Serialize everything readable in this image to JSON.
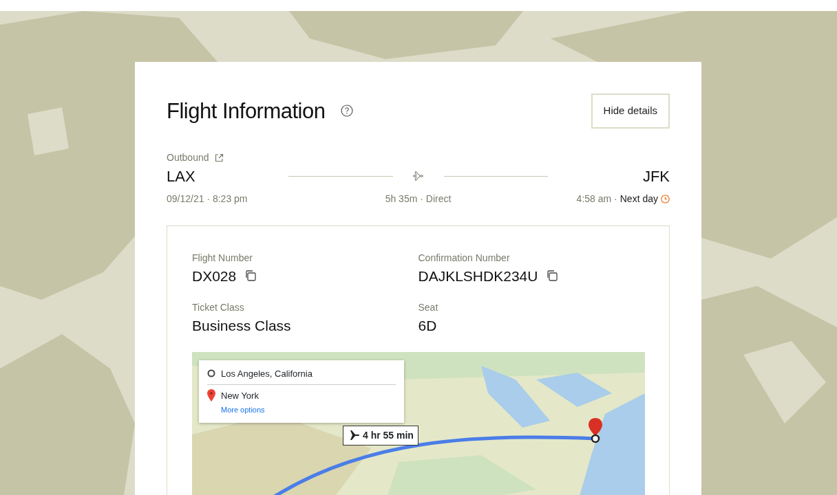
{
  "card": {
    "title": "Flight Information",
    "button": "Hide details"
  },
  "trip": {
    "label": "Outbound",
    "origin": "LAX",
    "destination": "JFK",
    "departure": "09/12/21 · 8:23 pm",
    "duration": "5h 35m · Direct",
    "arrival_time": "4:58 am ·",
    "arrival_note": "Next day"
  },
  "details": [
    {
      "label": "Flight Number",
      "value": "DX028",
      "copyable": true
    },
    {
      "label": "Confirmation Number",
      "value": "DAJKLSHDK234U",
      "copyable": true
    },
    {
      "label": "Ticket Class",
      "value": "Business Class",
      "copyable": false
    },
    {
      "label": "Seat",
      "value": "6D",
      "copyable": false
    }
  ],
  "map": {
    "kind": "picture",
    "directions": {
      "origin": "Los Angeles, California",
      "destination": "New York",
      "link": "More options"
    },
    "travel_time": "4 hr 55 min"
  }
}
